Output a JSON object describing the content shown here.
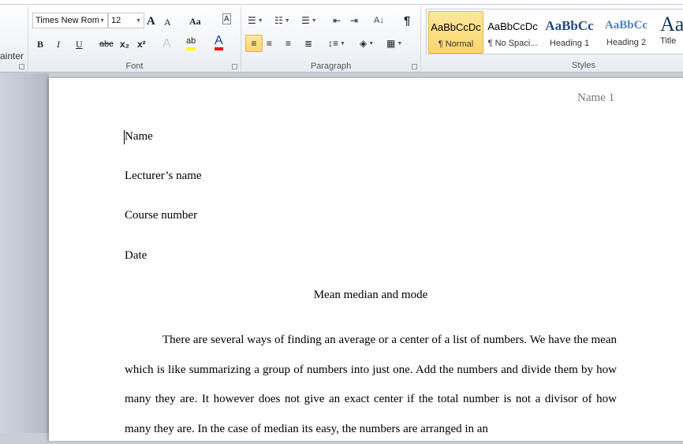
{
  "ribbon": {
    "clipboard_partial": "ainter",
    "font": {
      "label": "Font",
      "name": "Times New Rom",
      "size": "12",
      "grow": "A",
      "shrink": "A",
      "case": "Aa",
      "bold": "B",
      "italic": "I",
      "underline": "U",
      "strike": "abc",
      "sub": "x₂",
      "sup": "x²",
      "effects": "A",
      "highlight": "ab",
      "color": "A",
      "highlight_color": "#ffff00",
      "font_color": "#ff0000"
    },
    "paragraph": {
      "label": "Paragraph",
      "pilcrow": "¶",
      "sort": "A↓"
    },
    "styles": {
      "label": "Styles",
      "items": [
        {
          "preview": "AaBbCcDc",
          "name": "¶ Normal",
          "selected": true
        },
        {
          "preview": "AaBbCcDc",
          "name": "¶ No Spaci..."
        },
        {
          "preview": "AaBbCc",
          "name": "Heading 1"
        },
        {
          "preview": "AaBbCc",
          "name": "Heading 2"
        },
        {
          "preview": "Aa",
          "name": "Title"
        }
      ]
    }
  },
  "document": {
    "header": "Name 1",
    "lines": [
      "Name",
      "Lecturer’s name",
      "Course number",
      "Date"
    ],
    "title": "Mean median and mode",
    "paragraph": "There are several ways of finding an average or a center of a list of numbers. We have the mean which is like summarizing  a group of numbers into just one. Add the numbers and divide them by how many they are. It however does not give an exact center if the total number is not a divisor of how many they are. In the case of median its easy, the numbers are arranged in an"
  }
}
